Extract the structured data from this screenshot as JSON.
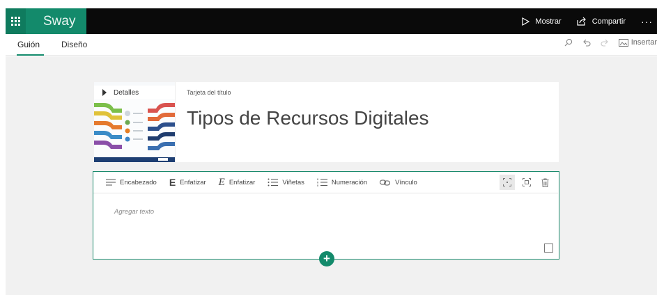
{
  "app": {
    "name": "Sway",
    "accent_color": "#138a6b",
    "header_color": "#0a0a0a"
  },
  "topbar": {
    "waffle_icon": "app-launcher-icon",
    "play_label": "Mostrar",
    "share_label": "Compartir",
    "more_label": "···"
  },
  "tabs": [
    {
      "label": "Guión",
      "active": true
    },
    {
      "label": "Diseño",
      "active": false
    }
  ],
  "tools_right": {
    "insert_label": "Insertar"
  },
  "title_card": {
    "details_label": "Detalles",
    "caption": "Tarjeta del título",
    "title": "Tipos de Recursos Digitales"
  },
  "text_card": {
    "toolbar": [
      {
        "label": "Encabezado",
        "icon": "heading-icon"
      },
      {
        "label": "Enfatizar",
        "icon": "emphasize-bold-icon"
      },
      {
        "label": "Enfatizar",
        "icon": "emphasize-italic-icon"
      },
      {
        "label": "Viñetas",
        "icon": "bullets-icon"
      },
      {
        "label": "Numeración",
        "icon": "numbering-icon"
      },
      {
        "label": "Vínculo",
        "icon": "link-icon"
      }
    ],
    "placeholder": "Agregar texto"
  },
  "add_card": "+"
}
